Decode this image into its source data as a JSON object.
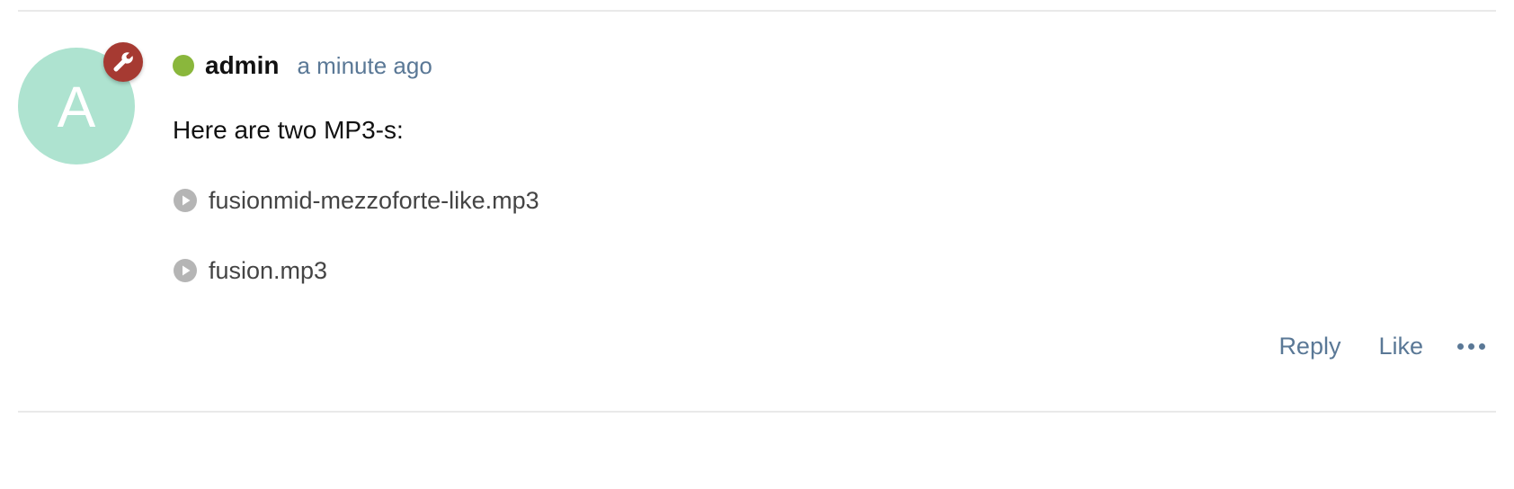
{
  "post": {
    "author": {
      "initial": "A",
      "username": "admin",
      "avatar_color": "#aee3d0",
      "moderator_badge_color": "#a63a32",
      "moderator_icon": "wrench-icon",
      "online_color": "#8ab73c"
    },
    "timestamp": "a minute ago",
    "body": "Here are two MP3-s:",
    "attachments": [
      {
        "name": "fusionmid-mezzoforte-like.mp3",
        "icon": "play-circle-icon"
      },
      {
        "name": "fusion.mp3",
        "icon": "play-circle-icon"
      }
    ],
    "attachment_icon_color": "#b5b5b5"
  },
  "actions": {
    "reply_label": "Reply",
    "like_label": "Like",
    "more_icon": "more-horizontal-icon",
    "color": "#5a7896"
  }
}
